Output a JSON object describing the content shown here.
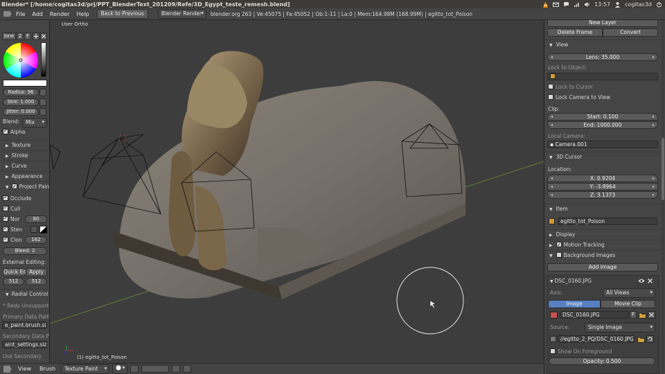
{
  "window": {
    "title": "Blender* [/home/cogitas3d/prj/PPT_BlenderText_201209/Refe/3D_Egypt_teste_remesh.blend]",
    "clock": "13:57",
    "user": "cogitas3d"
  },
  "menubar": {
    "items": [
      "File",
      "Add",
      "Render",
      "Help"
    ],
    "back_button": "Back to Previous",
    "engine": "Blender Render",
    "stats": "blender.org 263 | Ve:45075 | Fa:45052 | Ob:1-11 | La:0 | Mem:164.98M (168.99M) | egitto_tot_Poison"
  },
  "left_panel": {
    "brush_name": "lone",
    "brush_users": "2",
    "brush_fake": "F",
    "radius": "Radius: 96",
    "strength": "Stre: 1.000",
    "jitter": "Jitter: 0.000",
    "blend_label": "Blend:",
    "blend_value": "Mix",
    "alpha": "Alpha",
    "sections": [
      "Texture",
      "Stroke",
      "Curve",
      "Appearance"
    ],
    "project_paint": "Project Pain",
    "occlude": "Occlude",
    "cull": "Cull",
    "normal": "Nor",
    "normal_value": "80",
    "stencil": "Sten",
    "clone": "Clon",
    "clone_value": "162",
    "bleed": "Bleed: 2",
    "external_editing": "External Editing:",
    "quick_edit": "Quick Edi",
    "apply": "Apply",
    "size_x": "512",
    "size_y": "512",
    "radial_control": "Radial Control",
    "redo": "* Redo Unsupporte",
    "primary_label": "Primary Data Path",
    "primary_value": "e_paint.brush.size",
    "secondary_label": "Secondary Data Pa",
    "secondary_value": "aint_settings.size",
    "use_secondary": "Use Secondary"
  },
  "viewport": {
    "label": "User Ortho",
    "object_label": "(1) egitto_tot_Poison"
  },
  "bottombar": {
    "items": [
      "View",
      "Brush"
    ],
    "mode": "Texture Paint"
  },
  "right_panel": {
    "new_layer": "New Layer",
    "delete_frame": "Delete Frame",
    "convert": "Convert",
    "view_header": "View",
    "lens": "Lens: 35.000",
    "lock_to_object": "Lock to Object:",
    "lock_to_cursor": "Lock to Cursor",
    "lock_camera": "Lock Camera to View",
    "clip": "Clip:",
    "clip_start": "Start: 0.100",
    "clip_end": "End: 1000.000",
    "local_camera": "Local Camera:",
    "camera_name": "Camera.001",
    "cursor_header": "3D Cursor",
    "location": "Location:",
    "cx": "X: 0.9204",
    "cy": "Y: -3.8964",
    "cz": "Z: 3.1373",
    "item_header": "Item",
    "item_name": "egitto_tot_Poison",
    "display_header": "Display",
    "motion_tracking": "Motion Tracking",
    "background_images": "Background Images",
    "add_image": "Add Image",
    "image_name": "DSC_0160.JPG",
    "axis_label": "Axis:",
    "axis_value": "All Views",
    "tab_image": "Image",
    "tab_movie": "Movie Clip",
    "image_field": "DSC_0160.JPG",
    "image_fake": "F",
    "source_label": "Source:",
    "source_value": "Single Image",
    "filepath": "//egitto_2_PQ/DSC_0160.JPG",
    "show_foreground": "Show On Foreground",
    "opacity": "Opacity: 0.500"
  }
}
